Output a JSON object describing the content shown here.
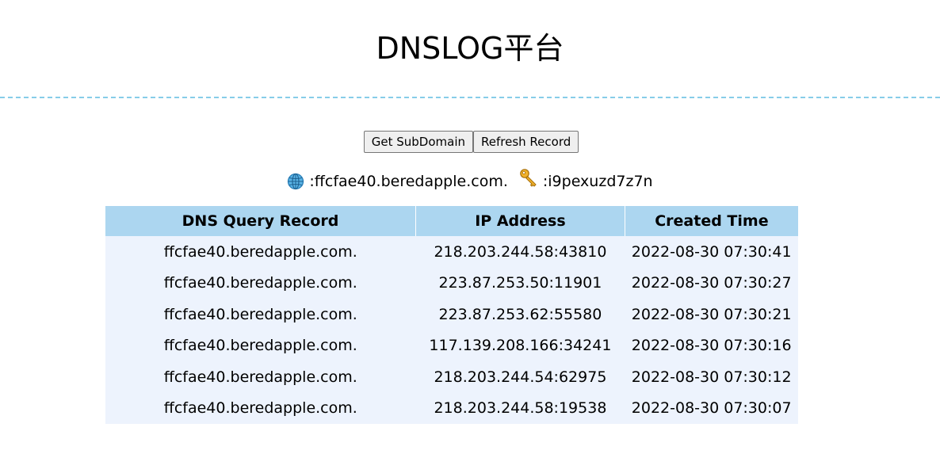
{
  "header": {
    "title": "DNSLOG平台"
  },
  "toolbar": {
    "get_subdomain_label": "Get SubDomain",
    "refresh_record_label": "Refresh Record"
  },
  "info": {
    "domain_icon": "globe-icon",
    "domain_text": ":ffcfae40.beredapple.com.",
    "token_icon": "key-icon",
    "token_text": ":i9pexuzd7z7n"
  },
  "table": {
    "headers": [
      "DNS Query Record",
      "IP Address",
      "Created Time"
    ],
    "rows": [
      [
        "ffcfae40.beredapple.com.",
        "218.203.244.58:43810",
        "2022-08-30 07:30:41"
      ],
      [
        "ffcfae40.beredapple.com.",
        "223.87.253.50:11901",
        "2022-08-30 07:30:27"
      ],
      [
        "ffcfae40.beredapple.com.",
        "223.87.253.62:55580",
        "2022-08-30 07:30:21"
      ],
      [
        "ffcfae40.beredapple.com.",
        "117.139.208.166:34241",
        "2022-08-30 07:30:16"
      ],
      [
        "ffcfae40.beredapple.com.",
        "218.203.244.54:62975",
        "2022-08-30 07:30:12"
      ],
      [
        "ffcfae40.beredapple.com.",
        "218.203.244.58:19538",
        "2022-08-30 07:30:07"
      ]
    ]
  },
  "colors": {
    "divider": "#87cde8",
    "table_header_bg": "#acd6f0",
    "table_row_bg": "#edf3fd"
  }
}
